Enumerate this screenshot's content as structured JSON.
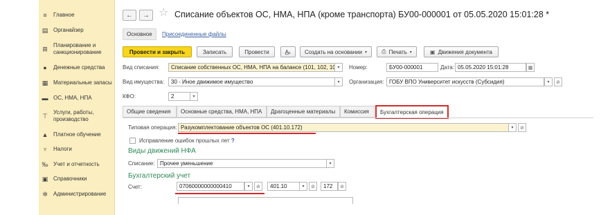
{
  "sidebar": {
    "items": [
      {
        "icon": "menu-icon",
        "glyph": "≡",
        "label": "Главное"
      },
      {
        "icon": "organizer-icon",
        "glyph": "▤",
        "label": "Органайзер"
      },
      {
        "icon": "planning-icon",
        "glyph": "⊞",
        "label": "Планирование и санкционирование"
      },
      {
        "icon": "money-icon",
        "glyph": "●",
        "label": "Денежные средства"
      },
      {
        "icon": "stock-icon",
        "glyph": "▦",
        "label": "Материальные запасы"
      },
      {
        "icon": "truck-icon",
        "glyph": "▬",
        "label": "ОС, НМА, НПА"
      },
      {
        "icon": "services-icon",
        "glyph": "⊤",
        "label": "Услуги, работы, производство"
      },
      {
        "icon": "education-icon",
        "glyph": "▲",
        "label": "Платное обучение"
      },
      {
        "icon": "taxes-icon",
        "glyph": "♆",
        "label": "Налоги"
      },
      {
        "icon": "reports-icon",
        "glyph": "‰",
        "label": "Учет и отчетность"
      },
      {
        "icon": "reference-icon",
        "glyph": "▣",
        "label": "Справочники"
      },
      {
        "icon": "gear-icon",
        "glyph": "✲",
        "label": "Администрирование"
      }
    ]
  },
  "header": {
    "back_icon": "←",
    "forward_icon": "→",
    "star_icon": "☆",
    "title": "Списание объектов ОС, НМА, НПА (кроме транспорта) БУ00-000001 от 05.05.2020 15:01:28 *"
  },
  "doc_tabs": {
    "main": "Основное",
    "attached": "Присоединенные файлы"
  },
  "toolbar": {
    "post_close": "Провести и закрыть",
    "save": "Записать",
    "post": "Провести",
    "dt_icon": "A̲ₖ",
    "create_based": "Создать на основании",
    "print": "Печать",
    "print_icon": "⎙",
    "movements": "Движения документа",
    "movements_icon": "▣",
    "caret": "▾"
  },
  "form": {
    "writeoff_type_label": "Вид списания:",
    "writeoff_type_value": "Списание собственных ОС, НМА, НПА на балансе (101, 102, 10",
    "number_label": "Номер:",
    "number_value": "БУ00-000001",
    "date_label": "Дата:",
    "date_value": "05.05.2020 15:01:28",
    "property_type_label": "Вид имущества:",
    "property_type_value": "30 - Иное движимое имущество",
    "org_label": "Организация:",
    "org_value": "ГОБУ ВПО Университет искусств (Субсидия)",
    "kfo_label": "КФО:",
    "kfo_value": "2"
  },
  "inner_tabs": [
    "Общие сведения",
    "Основные средства, НМА, НПА",
    "Драгоценные материалы",
    "Комиссия",
    "Бухгалтерская операция"
  ],
  "operation": {
    "typical_label": "Типовая операция:",
    "typical_value": "Разукомплектование объектов ОС (401.10.172)",
    "fix_errors_label": "Исправление ошибок прошлых лет",
    "help": "?",
    "nfa_section": "Виды движений НФА",
    "writeoff_label": "Списание:",
    "writeoff_value": "Прочее уменьшение",
    "accounting_section": "Бухгалтерский учет",
    "account_label": "Счет:",
    "account_value": "07060000000000410",
    "kps_value": "401.10",
    "kosgu_value": "172"
  },
  "colors": {
    "accent_yellow": "#f7d61b",
    "sidebar_bg": "#fbeec0",
    "highlight_red": "#d22a2a",
    "section_green": "#2e8b57"
  }
}
